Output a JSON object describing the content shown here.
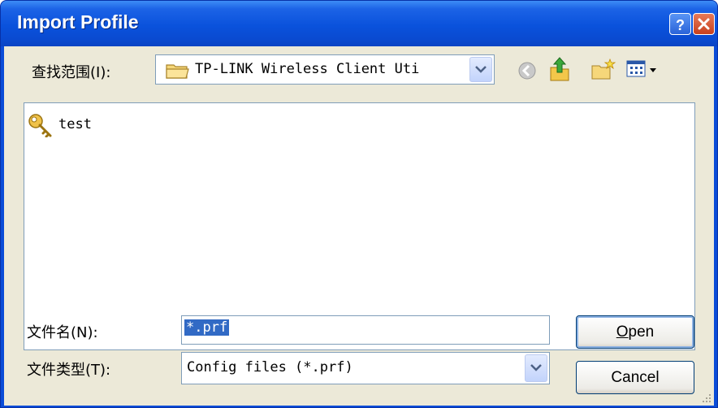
{
  "window": {
    "title": "Import Profile"
  },
  "colors": {
    "title_bar": "#0a52dc",
    "selection": "#316ac5",
    "dialog_bg": "#ece9d8",
    "close_button": "#c8401e"
  },
  "look_in": {
    "label": "查找范围(I):",
    "value": "TP-LINK Wireless Client Uti",
    "icon": "folder-icon"
  },
  "toolbar": {
    "back_icon": "back-arrow-icon",
    "up_icon": "up-folder-icon",
    "new_folder_icon": "new-folder-icon",
    "view_menu_icon": "view-menu-icon"
  },
  "files": [
    {
      "name": "test",
      "icon": "key-icon"
    }
  ],
  "file_name": {
    "label": "文件名(N):",
    "value": "*.prf"
  },
  "file_type": {
    "label": "文件类型(T):",
    "value": "Config files (*.prf)"
  },
  "buttons": {
    "open_mnemonic": "O",
    "open_rest": "pen",
    "cancel": "Cancel"
  }
}
